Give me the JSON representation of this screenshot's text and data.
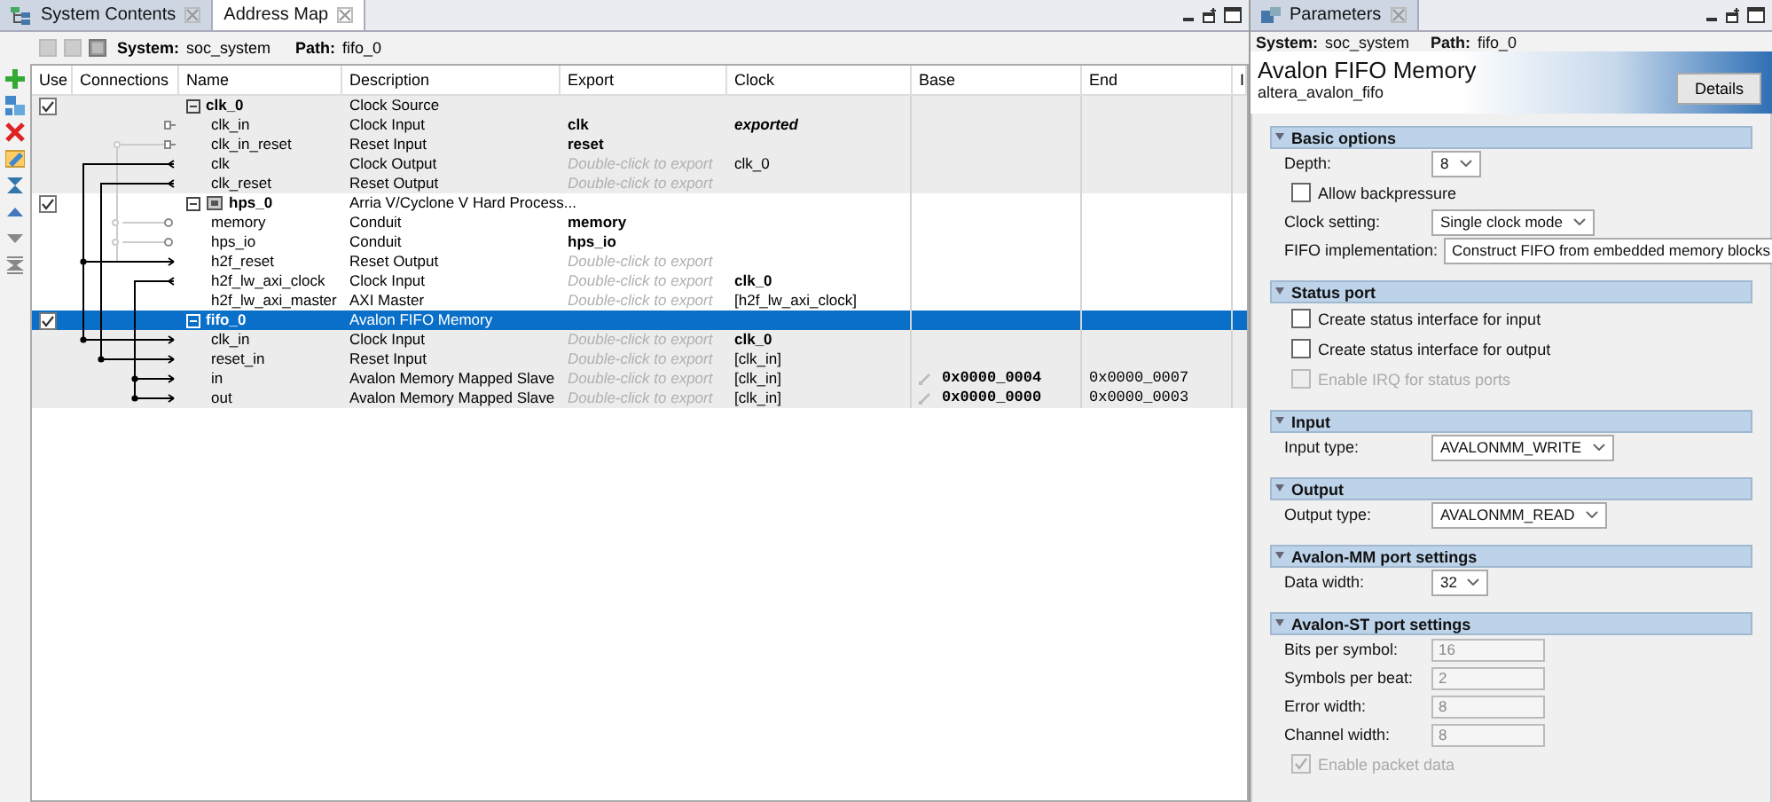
{
  "left_panel": {
    "tabs": [
      {
        "label": "System Contents",
        "selected": true
      },
      {
        "label": "Address Map",
        "selected": false
      }
    ],
    "breadcrumb": {
      "system_label": "System:",
      "system": "soc_system",
      "path_label": "Path:",
      "path": "fifo_0"
    },
    "table": {
      "columns": [
        "Use",
        "Connections",
        "Name",
        "Description",
        "Export",
        "Clock",
        "Base",
        "End",
        "I"
      ],
      "rows": [
        {
          "kind": "module",
          "name": "clk_0",
          "description": "Clock Source",
          "checked": true,
          "expanded": true,
          "selected": false
        },
        {
          "kind": "port",
          "name": "clk_in",
          "description": "Clock Input",
          "export": {
            "text": "clk",
            "kind": "exported"
          },
          "clock": {
            "text": "exported",
            "kind": "italic"
          },
          "selected": false
        },
        {
          "kind": "port",
          "name": "clk_in_reset",
          "description": "Reset Input",
          "export": {
            "text": "reset",
            "kind": "exported"
          },
          "selected": false
        },
        {
          "kind": "port",
          "name": "clk",
          "description": "Clock Output",
          "export": {
            "text": "Double-click to export",
            "kind": "hint"
          },
          "clock": {
            "text": "clk_0",
            "kind": "plain"
          },
          "selected": false
        },
        {
          "kind": "port",
          "name": "clk_reset",
          "description": "Reset Output",
          "export": {
            "text": "Double-click to export",
            "kind": "hint"
          },
          "selected": false
        },
        {
          "kind": "module",
          "name": "hps_0",
          "description": "Arria V/Cyclone V Hard Process...",
          "checked": true,
          "expanded": true,
          "selected": false
        },
        {
          "kind": "port",
          "name": "memory",
          "description": "Conduit",
          "export": {
            "text": "memory",
            "kind": "exported"
          },
          "selected": false
        },
        {
          "kind": "port",
          "name": "hps_io",
          "description": "Conduit",
          "export": {
            "text": "hps_io",
            "kind": "exported"
          },
          "selected": false
        },
        {
          "kind": "port",
          "name": "h2f_reset",
          "description": "Reset Output",
          "export": {
            "text": "Double-click to export",
            "kind": "hint"
          },
          "selected": false
        },
        {
          "kind": "port",
          "name": "h2f_lw_axi_clock",
          "description": "Clock Input",
          "export": {
            "text": "Double-click to export",
            "kind": "hint"
          },
          "clock": {
            "text": "clk_0",
            "kind": "bold"
          },
          "selected": false
        },
        {
          "kind": "port",
          "name": "h2f_lw_axi_master",
          "description": "AXI Master",
          "export": {
            "text": "Double-click to export",
            "kind": "hint"
          },
          "clock": {
            "text": "[h2f_lw_axi_clock]",
            "kind": "plain"
          },
          "selected": false
        },
        {
          "kind": "module",
          "name": "fifo_0",
          "description": "Avalon FIFO Memory",
          "checked": true,
          "expanded": true,
          "selected": true
        },
        {
          "kind": "port",
          "name": "clk_in",
          "description": "Clock Input",
          "export": {
            "text": "Double-click to export",
            "kind": "hint"
          },
          "clock": {
            "text": "clk_0",
            "kind": "bold"
          },
          "selected": false
        },
        {
          "kind": "port",
          "name": "reset_in",
          "description": "Reset Input",
          "export": {
            "text": "Double-click to export",
            "kind": "hint"
          },
          "clock": {
            "text": "[clk_in]",
            "kind": "plain"
          },
          "selected": false
        },
        {
          "kind": "port",
          "name": "in",
          "description": "Avalon Memory Mapped Slave",
          "export": {
            "text": "Double-click to export",
            "kind": "hint"
          },
          "clock": {
            "text": "[clk_in]",
            "kind": "plain"
          },
          "base": "0x0000_0004",
          "end": "0x0000_0007",
          "selected": false
        },
        {
          "kind": "port",
          "name": "out",
          "description": "Avalon Memory Mapped Slave",
          "export": {
            "text": "Double-click to export",
            "kind": "hint"
          },
          "clock": {
            "text": "[clk_in]",
            "kind": "plain"
          },
          "base": "0x0000_0000",
          "end": "0x0000_0003",
          "selected": false
        }
      ]
    }
  },
  "parameters": {
    "tab": "Parameters",
    "breadcrumb": {
      "system_label": "System:",
      "system": "soc_system",
      "path_label": "Path:",
      "path": "fifo_0"
    },
    "title": "Avalon FIFO Memory",
    "subtitle": "altera_avalon_fifo",
    "details_button": "Details",
    "sections": [
      {
        "title": "Basic options",
        "expanded": true,
        "fields": [
          {
            "kind": "select",
            "label": "Depth:",
            "value": "8",
            "disabled": false
          },
          {
            "kind": "checkbox",
            "label": "Allow backpressure",
            "checked": false,
            "disabled": false
          },
          {
            "kind": "select",
            "label": "Clock setting:",
            "value": "Single clock mode",
            "disabled": false
          },
          {
            "kind": "select",
            "label": "FIFO implementation:",
            "value": "Construct FIFO from embedded memory blocks",
            "disabled": false
          }
        ]
      },
      {
        "title": "Status port",
        "expanded": true,
        "fields": [
          {
            "kind": "checkbox",
            "label": "Create status interface for input",
            "checked": false,
            "disabled": false
          },
          {
            "kind": "checkbox",
            "label": "Create status interface for output",
            "checked": false,
            "disabled": false
          },
          {
            "kind": "checkbox",
            "label": "Enable IRQ for status ports",
            "checked": false,
            "disabled": true
          }
        ]
      },
      {
        "title": "Input",
        "expanded": true,
        "fields": [
          {
            "kind": "select",
            "label": "Input type:",
            "value": "AVALONMM_WRITE",
            "disabled": false
          }
        ]
      },
      {
        "title": "Output",
        "expanded": true,
        "fields": [
          {
            "kind": "select",
            "label": "Output type:",
            "value": "AVALONMM_READ",
            "disabled": false
          }
        ]
      },
      {
        "title": "Avalon-MM port settings",
        "expanded": true,
        "fields": [
          {
            "kind": "select",
            "label": "Data width:",
            "value": "32",
            "disabled": false
          }
        ]
      },
      {
        "title": "Avalon-ST port settings",
        "expanded": true,
        "fields": [
          {
            "kind": "text",
            "label": "Bits per symbol:",
            "value": "16",
            "disabled": true
          },
          {
            "kind": "text",
            "label": "Symbols per beat:",
            "value": "2",
            "disabled": true
          },
          {
            "kind": "text",
            "label": "Error width:",
            "value": "8",
            "disabled": true
          },
          {
            "kind": "text",
            "label": "Channel width:",
            "value": "8",
            "disabled": true
          },
          {
            "kind": "checkbox",
            "label": "Enable packet data",
            "checked": true,
            "disabled": true
          }
        ]
      }
    ]
  }
}
